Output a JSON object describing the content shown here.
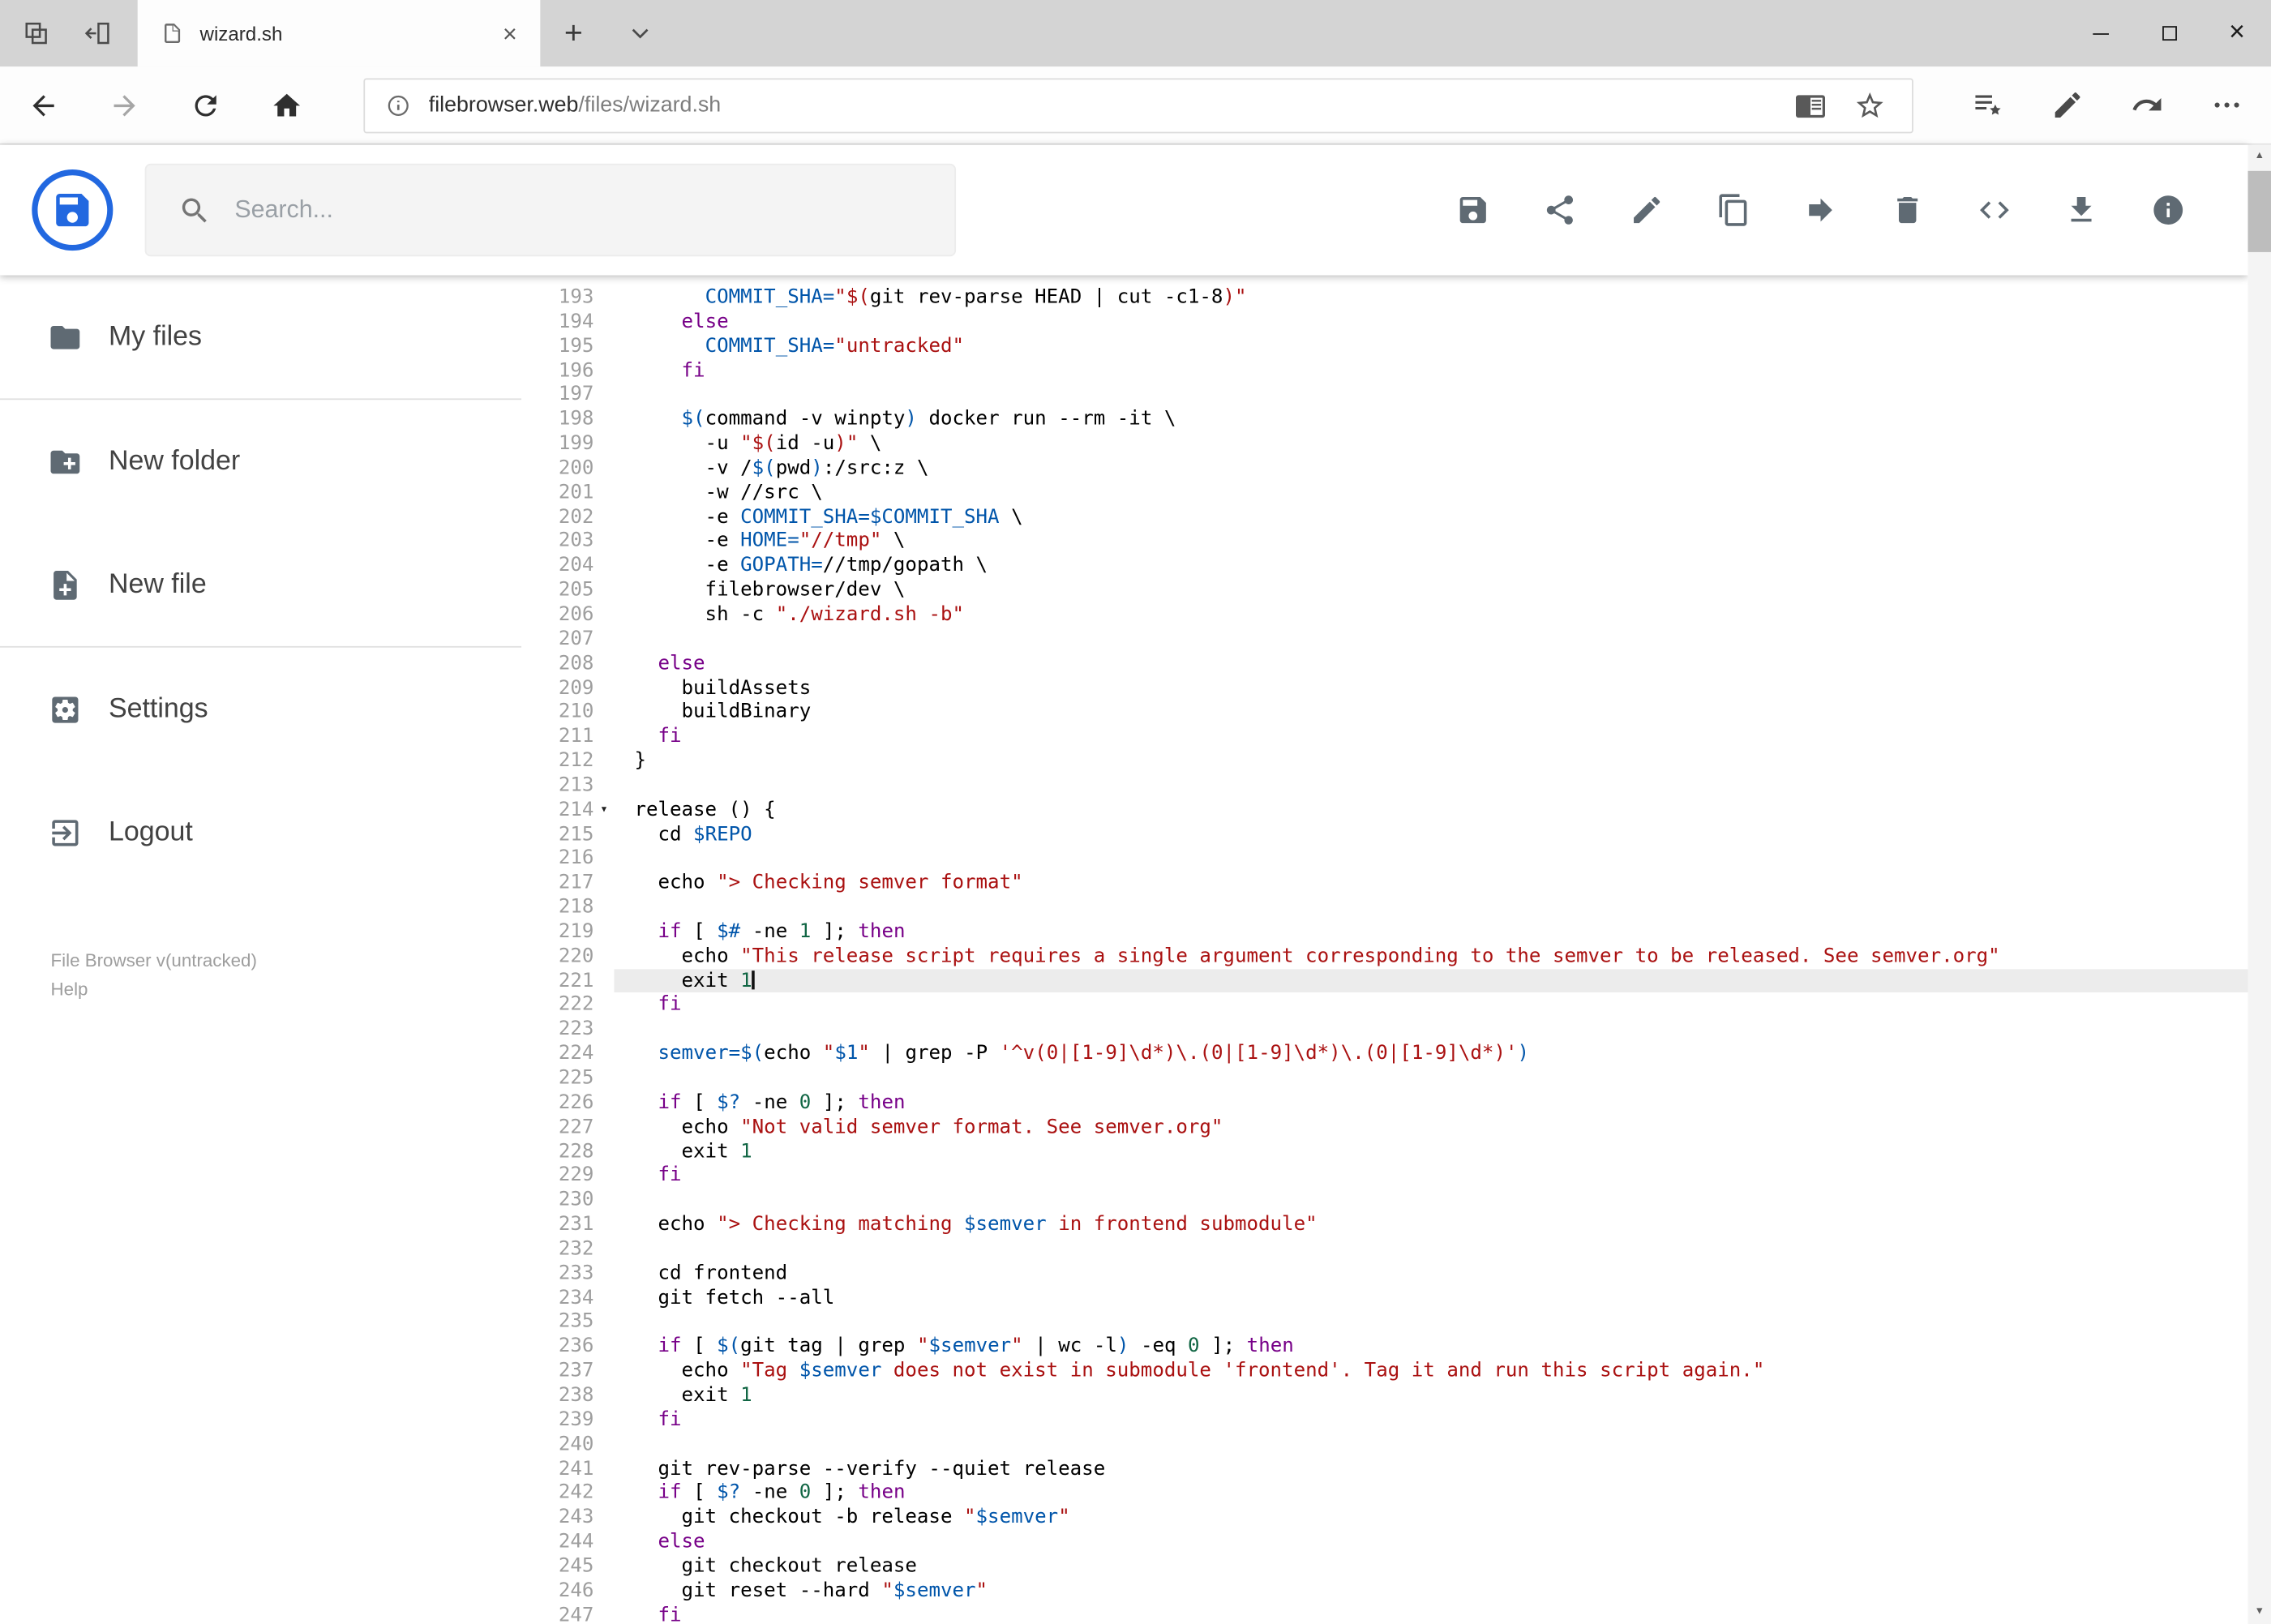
{
  "colors": {
    "brand_blue": "#2268e0",
    "icon_gray": "#5f6a73",
    "kw": "#770088",
    "str": "#aa1111",
    "vr": "#0055aa",
    "num": "#116644",
    "active_line": "#ececec",
    "gutter": "#9e9e9e"
  },
  "browser": {
    "tab": {
      "title": "wizard.sh"
    },
    "url": {
      "domain": "filebrowser.web",
      "path": "/files/wizard.sh"
    }
  },
  "app": {
    "search": {
      "placeholder": "Search..."
    },
    "toolbar_icons": [
      "save",
      "share",
      "rename",
      "copy",
      "move",
      "delete",
      "source-code",
      "download",
      "info"
    ],
    "sidebar": {
      "items": [
        {
          "label": "My files",
          "icon": "folder"
        },
        {
          "label": "New folder",
          "icon": "new-folder"
        },
        {
          "label": "New file",
          "icon": "new-file"
        },
        {
          "label": "Settings",
          "icon": "settings"
        },
        {
          "label": "Logout",
          "icon": "logout"
        }
      ],
      "footer": {
        "version": "File Browser v(untracked)",
        "help": "Help"
      }
    }
  },
  "editor": {
    "active_line": 221,
    "lines": [
      {
        "n": 193,
        "t": [
          [
            "",
            "      "
          ],
          [
            "v",
            "COMMIT_SHA="
          ],
          [
            "s",
            "\"$("
          ],
          [
            "",
            "git rev-parse HEAD | cut -c1-8"
          ],
          [
            "s",
            ")\""
          ]
        ]
      },
      {
        "n": 194,
        "t": [
          [
            "",
            "    "
          ],
          [
            "k",
            "else"
          ]
        ]
      },
      {
        "n": 195,
        "t": [
          [
            "",
            "      "
          ],
          [
            "v",
            "COMMIT_SHA="
          ],
          [
            "s",
            "\"untracked\""
          ]
        ]
      },
      {
        "n": 196,
        "t": [
          [
            "",
            "    "
          ],
          [
            "k",
            "fi"
          ]
        ]
      },
      {
        "n": 197,
        "t": []
      },
      {
        "n": 198,
        "t": [
          [
            "",
            "    "
          ],
          [
            "v",
            "$("
          ],
          [
            "",
            "command -v winpty"
          ],
          [
            "v",
            ")"
          ],
          [
            "",
            " docker run --rm -it \\"
          ]
        ]
      },
      {
        "n": 199,
        "t": [
          [
            "",
            "      -u "
          ],
          [
            "s",
            "\"$("
          ],
          [
            "",
            "id -u"
          ],
          [
            "s",
            ")\""
          ],
          [
            "",
            " \\"
          ]
        ]
      },
      {
        "n": 200,
        "t": [
          [
            "",
            "      -v /"
          ],
          [
            "v",
            "$("
          ],
          [
            "",
            "pwd"
          ],
          [
            "v",
            ")"
          ],
          [
            "",
            ":/src:z \\"
          ]
        ]
      },
      {
        "n": 201,
        "t": [
          [
            "",
            "      -w //src \\"
          ]
        ]
      },
      {
        "n": 202,
        "t": [
          [
            "",
            "      -e "
          ],
          [
            "v",
            "COMMIT_SHA=$COMMIT_SHA"
          ],
          [
            "",
            " \\"
          ]
        ]
      },
      {
        "n": 203,
        "t": [
          [
            "",
            "      -e "
          ],
          [
            "v",
            "HOME="
          ],
          [
            "s",
            "\"//tmp\""
          ],
          [
            "",
            " \\"
          ]
        ]
      },
      {
        "n": 204,
        "t": [
          [
            "",
            "      -e "
          ],
          [
            "v",
            "GOPATH="
          ],
          [
            "",
            "//tmp/gopath \\"
          ]
        ]
      },
      {
        "n": 205,
        "t": [
          [
            "",
            "      filebrowser/dev \\"
          ]
        ]
      },
      {
        "n": 206,
        "t": [
          [
            "",
            "      sh -c "
          ],
          [
            "s",
            "\"./wizard.sh -b\""
          ]
        ]
      },
      {
        "n": 207,
        "t": []
      },
      {
        "n": 208,
        "t": [
          [
            "",
            "  "
          ],
          [
            "k",
            "else"
          ]
        ]
      },
      {
        "n": 209,
        "t": [
          [
            "",
            "    buildAssets"
          ]
        ]
      },
      {
        "n": 210,
        "t": [
          [
            "",
            "    buildBinary"
          ]
        ]
      },
      {
        "n": 211,
        "t": [
          [
            "",
            "  "
          ],
          [
            "k",
            "fi"
          ]
        ]
      },
      {
        "n": 212,
        "t": [
          [
            "",
            "}"
          ]
        ]
      },
      {
        "n": 213,
        "t": []
      },
      {
        "n": 214,
        "fold": true,
        "t": [
          [
            "",
            "release () {"
          ]
        ]
      },
      {
        "n": 215,
        "t": [
          [
            "",
            "  cd "
          ],
          [
            "v",
            "$REPO"
          ]
        ]
      },
      {
        "n": 216,
        "t": []
      },
      {
        "n": 217,
        "t": [
          [
            "",
            "  echo "
          ],
          [
            "s",
            "\"> Checking semver format\""
          ]
        ]
      },
      {
        "n": 218,
        "t": []
      },
      {
        "n": 219,
        "t": [
          [
            "",
            "  "
          ],
          [
            "k",
            "if"
          ],
          [
            "",
            " [ "
          ],
          [
            "v",
            "$#"
          ],
          [
            "",
            " -ne "
          ],
          [
            "n",
            "1"
          ],
          [
            "",
            " ]; "
          ],
          [
            "k",
            "then"
          ]
        ]
      },
      {
        "n": 220,
        "t": [
          [
            "",
            "    echo "
          ],
          [
            "s",
            "\"This release script requires a single argument corresponding to the semver to be released. See semver.org\""
          ]
        ]
      },
      {
        "n": 221,
        "t": [
          [
            "",
            "    exit "
          ],
          [
            "n",
            "1"
          ]
        ]
      },
      {
        "n": 222,
        "t": [
          [
            "",
            "  "
          ],
          [
            "k",
            "fi"
          ]
        ]
      },
      {
        "n": 223,
        "t": []
      },
      {
        "n": 224,
        "t": [
          [
            "",
            "  "
          ],
          [
            "v",
            "semver=$("
          ],
          [
            "",
            "echo "
          ],
          [
            "s",
            "\""
          ],
          [
            "v",
            "$1"
          ],
          [
            "s",
            "\""
          ],
          [
            "",
            " | grep -P "
          ],
          [
            "s",
            "'^v(0|[1-9]\\d*)\\.(0|[1-9]\\d*)\\.(0|[1-9]\\d*)'"
          ],
          [
            "v",
            ")"
          ]
        ]
      },
      {
        "n": 225,
        "t": []
      },
      {
        "n": 226,
        "t": [
          [
            "",
            "  "
          ],
          [
            "k",
            "if"
          ],
          [
            "",
            " [ "
          ],
          [
            "v",
            "$?"
          ],
          [
            "",
            " -ne "
          ],
          [
            "n",
            "0"
          ],
          [
            "",
            " ]; "
          ],
          [
            "k",
            "then"
          ]
        ]
      },
      {
        "n": 227,
        "t": [
          [
            "",
            "    echo "
          ],
          [
            "s",
            "\"Not valid semver format. See semver.org\""
          ]
        ]
      },
      {
        "n": 228,
        "t": [
          [
            "",
            "    exit "
          ],
          [
            "n",
            "1"
          ]
        ]
      },
      {
        "n": 229,
        "t": [
          [
            "",
            "  "
          ],
          [
            "k",
            "fi"
          ]
        ]
      },
      {
        "n": 230,
        "t": []
      },
      {
        "n": 231,
        "t": [
          [
            "",
            "  echo "
          ],
          [
            "s",
            "\"> Checking matching "
          ],
          [
            "v",
            "$semver"
          ],
          [
            "s",
            " in frontend submodule\""
          ]
        ]
      },
      {
        "n": 232,
        "t": []
      },
      {
        "n": 233,
        "t": [
          [
            "",
            "  cd frontend"
          ]
        ]
      },
      {
        "n": 234,
        "t": [
          [
            "",
            "  git fetch --all"
          ]
        ]
      },
      {
        "n": 235,
        "t": []
      },
      {
        "n": 236,
        "t": [
          [
            "",
            "  "
          ],
          [
            "k",
            "if"
          ],
          [
            "",
            " [ "
          ],
          [
            "v",
            "$("
          ],
          [
            "",
            "git tag | grep "
          ],
          [
            "s",
            "\""
          ],
          [
            "v",
            "$semver"
          ],
          [
            "s",
            "\""
          ],
          [
            "",
            " | wc -l"
          ],
          [
            "v",
            ")"
          ],
          [
            "",
            " -eq "
          ],
          [
            "n",
            "0"
          ],
          [
            "",
            " ]; "
          ],
          [
            "k",
            "then"
          ]
        ]
      },
      {
        "n": 237,
        "t": [
          [
            "",
            "    echo "
          ],
          [
            "s",
            "\"Tag "
          ],
          [
            "v",
            "$semver"
          ],
          [
            "s",
            " does not exist in submodule 'frontend'. Tag it and run this script again.\""
          ]
        ]
      },
      {
        "n": 238,
        "t": [
          [
            "",
            "    exit "
          ],
          [
            "n",
            "1"
          ]
        ]
      },
      {
        "n": 239,
        "t": [
          [
            "",
            "  "
          ],
          [
            "k",
            "fi"
          ]
        ]
      },
      {
        "n": 240,
        "t": []
      },
      {
        "n": 241,
        "t": [
          [
            "",
            "  git rev-parse --verify --quiet release"
          ]
        ]
      },
      {
        "n": 242,
        "t": [
          [
            "",
            "  "
          ],
          [
            "k",
            "if"
          ],
          [
            "",
            " [ "
          ],
          [
            "v",
            "$?"
          ],
          [
            "",
            " -ne "
          ],
          [
            "n",
            "0"
          ],
          [
            "",
            " ]; "
          ],
          [
            "k",
            "then"
          ]
        ]
      },
      {
        "n": 243,
        "t": [
          [
            "",
            "    git checkout -b release "
          ],
          [
            "s",
            "\""
          ],
          [
            "v",
            "$semver"
          ],
          [
            "s",
            "\""
          ]
        ]
      },
      {
        "n": 244,
        "t": [
          [
            "",
            "  "
          ],
          [
            "k",
            "else"
          ]
        ]
      },
      {
        "n": 245,
        "t": [
          [
            "",
            "    git checkout release"
          ]
        ]
      },
      {
        "n": 246,
        "t": [
          [
            "",
            "    git reset --hard "
          ],
          [
            "s",
            "\""
          ],
          [
            "v",
            "$semver"
          ],
          [
            "s",
            "\""
          ]
        ]
      },
      {
        "n": 247,
        "t": [
          [
            "",
            "  "
          ],
          [
            "k",
            "fi"
          ]
        ]
      }
    ]
  }
}
